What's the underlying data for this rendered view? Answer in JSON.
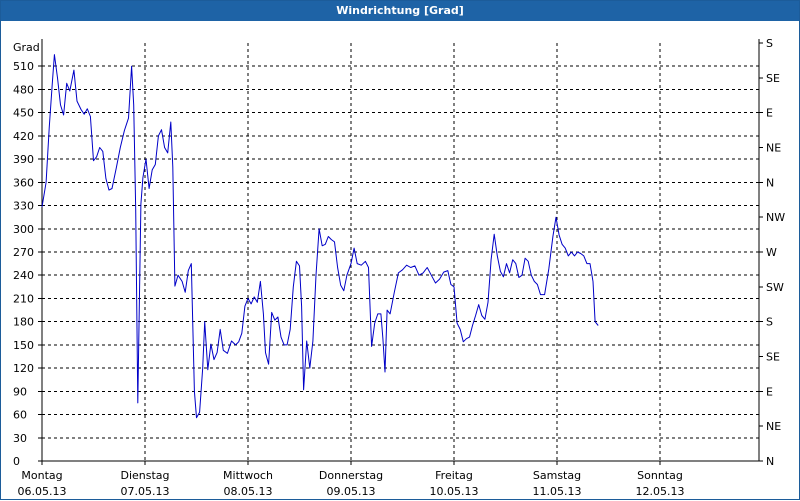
{
  "window": {
    "title": "Windrichtung [Grad]"
  },
  "colors": {
    "title_bar": "#1e63a6",
    "line": "#0000c8",
    "grid": "#000000",
    "axis": "#000000"
  },
  "chart_data": {
    "type": "line",
    "title": "Windrichtung [Grad]",
    "ylabel": "Grad",
    "ylim": [
      0,
      540
    ],
    "grid": true,
    "y_ticks": [
      0,
      30,
      60,
      90,
      120,
      150,
      180,
      210,
      240,
      270,
      300,
      330,
      360,
      390,
      420,
      450,
      480,
      510
    ],
    "x_range": [
      0,
      7
    ],
    "x_tick_labels": [
      {
        "day": "Montag",
        "date": "06.05.13"
      },
      {
        "day": "Dienstag",
        "date": "07.05.13"
      },
      {
        "day": "Mittwoch",
        "date": "08.05.13"
      },
      {
        "day": "Donnerstag",
        "date": "09.05.13"
      },
      {
        "day": "Freitag",
        "date": "10.05.13"
      },
      {
        "day": "Samstag",
        "date": "11.05.13"
      },
      {
        "day": "Sonntag",
        "date": "12.05.13"
      }
    ],
    "right_axis_labels": [
      "S",
      "SE",
      "E",
      "NE",
      "N",
      "NW",
      "W",
      "SW",
      "S",
      "SE",
      "E",
      "NE",
      "N"
    ],
    "series": [
      {
        "points": [
          [
            0.0,
            328
          ],
          [
            0.04,
            360
          ],
          [
            0.07,
            430
          ],
          [
            0.1,
            488
          ],
          [
            0.12,
            525
          ],
          [
            0.15,
            495
          ],
          [
            0.18,
            460
          ],
          [
            0.21,
            447
          ],
          [
            0.24,
            488
          ],
          [
            0.27,
            478
          ],
          [
            0.31,
            505
          ],
          [
            0.34,
            465
          ],
          [
            0.38,
            454
          ],
          [
            0.41,
            448
          ],
          [
            0.44,
            455
          ],
          [
            0.47,
            445
          ],
          [
            0.5,
            388
          ],
          [
            0.53,
            393
          ],
          [
            0.56,
            405
          ],
          [
            0.59,
            400
          ],
          [
            0.62,
            365
          ],
          [
            0.65,
            350
          ],
          [
            0.68,
            352
          ],
          [
            0.72,
            378
          ],
          [
            0.76,
            405
          ],
          [
            0.8,
            427
          ],
          [
            0.84,
            443
          ],
          [
            0.87,
            510
          ],
          [
            0.89,
            460
          ],
          [
            0.91,
            325
          ],
          [
            0.93,
            75
          ],
          [
            0.96,
            332
          ],
          [
            0.98,
            366
          ],
          [
            1.01,
            390
          ],
          [
            1.04,
            352
          ],
          [
            1.07,
            376
          ],
          [
            1.1,
            383
          ],
          [
            1.13,
            420
          ],
          [
            1.16,
            428
          ],
          [
            1.19,
            405
          ],
          [
            1.22,
            398
          ],
          [
            1.25,
            438
          ],
          [
            1.27,
            380
          ],
          [
            1.29,
            226
          ],
          [
            1.32,
            240
          ],
          [
            1.36,
            232
          ],
          [
            1.39,
            218
          ],
          [
            1.42,
            246
          ],
          [
            1.45,
            255
          ],
          [
            1.48,
            90
          ],
          [
            1.5,
            56
          ],
          [
            1.53,
            63
          ],
          [
            1.56,
            120
          ],
          [
            1.58,
            180
          ],
          [
            1.61,
            118
          ],
          [
            1.64,
            151
          ],
          [
            1.67,
            131
          ],
          [
            1.7,
            140
          ],
          [
            1.73,
            170
          ],
          [
            1.76,
            143
          ],
          [
            1.8,
            139
          ],
          [
            1.84,
            155
          ],
          [
            1.88,
            150
          ],
          [
            1.91,
            154
          ],
          [
            1.94,
            165
          ],
          [
            1.97,
            200
          ],
          [
            2.0,
            210
          ],
          [
            2.03,
            203
          ],
          [
            2.06,
            212
          ],
          [
            2.09,
            205
          ],
          [
            2.12,
            232
          ],
          [
            2.15,
            190
          ],
          [
            2.17,
            140
          ],
          [
            2.2,
            125
          ],
          [
            2.23,
            192
          ],
          [
            2.26,
            182
          ],
          [
            2.29,
            186
          ],
          [
            2.32,
            160
          ],
          [
            2.35,
            150
          ],
          [
            2.38,
            150
          ],
          [
            2.41,
            170
          ],
          [
            2.44,
            225
          ],
          [
            2.47,
            258
          ],
          [
            2.5,
            252
          ],
          [
            2.52,
            200
          ],
          [
            2.54,
            92
          ],
          [
            2.57,
            155
          ],
          [
            2.6,
            120
          ],
          [
            2.63,
            155
          ],
          [
            2.66,
            240
          ],
          [
            2.69,
            300
          ],
          [
            2.72,
            278
          ],
          [
            2.75,
            280
          ],
          [
            2.78,
            290
          ],
          [
            2.81,
            286
          ],
          [
            2.84,
            283
          ],
          [
            2.87,
            250
          ],
          [
            2.9,
            227
          ],
          [
            2.93,
            220
          ],
          [
            2.96,
            240
          ],
          [
            3.0,
            255
          ],
          [
            3.03,
            275
          ],
          [
            3.06,
            255
          ],
          [
            3.1,
            253
          ],
          [
            3.14,
            258
          ],
          [
            3.17,
            250
          ],
          [
            3.2,
            148
          ],
          [
            3.23,
            178
          ],
          [
            3.26,
            190
          ],
          [
            3.29,
            190
          ],
          [
            3.31,
            158
          ],
          [
            3.33,
            115
          ],
          [
            3.35,
            195
          ],
          [
            3.38,
            190
          ],
          [
            3.42,
            218
          ],
          [
            3.46,
            243
          ],
          [
            3.5,
            247
          ],
          [
            3.54,
            253
          ],
          [
            3.58,
            250
          ],
          [
            3.62,
            252
          ],
          [
            3.66,
            240
          ],
          [
            3.7,
            243
          ],
          [
            3.74,
            250
          ],
          [
            3.78,
            240
          ],
          [
            3.82,
            230
          ],
          [
            3.86,
            235
          ],
          [
            3.9,
            244
          ],
          [
            3.94,
            246
          ],
          [
            3.97,
            228
          ],
          [
            4.0,
            225
          ],
          [
            4.03,
            178
          ],
          [
            4.06,
            170
          ],
          [
            4.09,
            154
          ],
          [
            4.12,
            158
          ],
          [
            4.15,
            160
          ],
          [
            4.18,
            175
          ],
          [
            4.21,
            188
          ],
          [
            4.24,
            202
          ],
          [
            4.27,
            188
          ],
          [
            4.3,
            183
          ],
          [
            4.33,
            205
          ],
          [
            4.36,
            260
          ],
          [
            4.39,
            293
          ],
          [
            4.42,
            265
          ],
          [
            4.45,
            245
          ],
          [
            4.48,
            238
          ],
          [
            4.51,
            255
          ],
          [
            4.54,
            243
          ],
          [
            4.57,
            260
          ],
          [
            4.6,
            255
          ],
          [
            4.63,
            237
          ],
          [
            4.66,
            240
          ],
          [
            4.69,
            262
          ],
          [
            4.72,
            258
          ],
          [
            4.75,
            240
          ],
          [
            4.78,
            232
          ],
          [
            4.81,
            228
          ],
          [
            4.84,
            215
          ],
          [
            4.88,
            215
          ],
          [
            4.92,
            248
          ],
          [
            4.96,
            290
          ],
          [
            4.99,
            315
          ],
          [
            5.02,
            292
          ],
          [
            5.05,
            280
          ],
          [
            5.08,
            275
          ],
          [
            5.11,
            265
          ],
          [
            5.14,
            270
          ],
          [
            5.17,
            265
          ],
          [
            5.2,
            270
          ],
          [
            5.23,
            268
          ],
          [
            5.26,
            265
          ],
          [
            5.29,
            255
          ],
          [
            5.32,
            255
          ],
          [
            5.35,
            232
          ],
          [
            5.37,
            180
          ],
          [
            5.4,
            175
          ]
        ]
      }
    ]
  }
}
